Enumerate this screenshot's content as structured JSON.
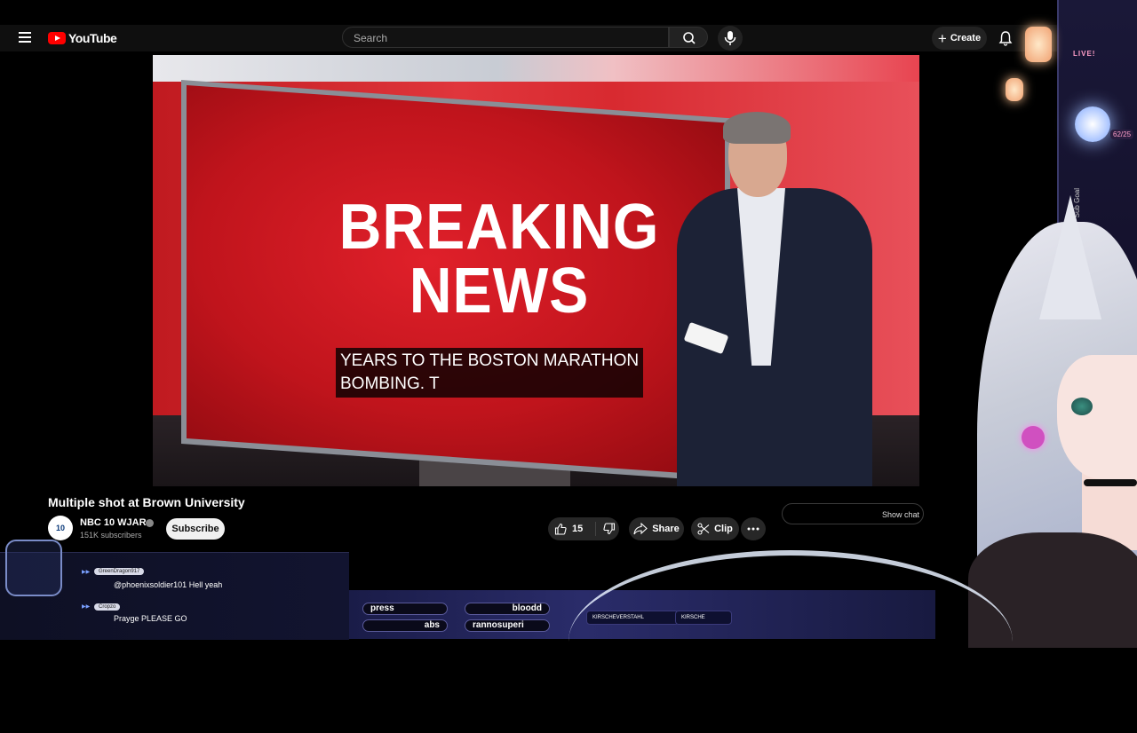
{
  "header": {
    "logo_text": "YouTube",
    "search_placeholder": "Search",
    "create_label": "Create"
  },
  "video": {
    "headline_line1": "BREAKING",
    "headline_line2": "NEWS",
    "caption_line1": "YEARS TO THE BOSTON MARATHON",
    "caption_line2": "BOMBING. T"
  },
  "meta": {
    "title": "Multiple shot at Brown University",
    "channel_name": "NBC 10 WJAR",
    "channel_avatar_text": "10",
    "subscribers": "151K subscribers",
    "subscribe_label": "Subscribe",
    "like_count": "15",
    "share_label": "Share",
    "clip_label": "Clip",
    "show_chat_label": "Show chat"
  },
  "stream_overlay": {
    "live_label": "LIVE!",
    "goal_count": "62/25",
    "goal_label": "Sub Goal",
    "chat": [
      {
        "user": "GreenDragon917",
        "message": "@phoenixsoldier101 Hell yeah"
      },
      {
        "user": "Cropzo",
        "message": "Prayge PLEASE GO"
      }
    ],
    "ticker_items": [
      "press",
      "bloodd",
      "abs",
      "rannosuperi"
    ],
    "socials": [
      "KIRSCHEVERSTAHL",
      "KIRSCHE"
    ]
  },
  "colors": {
    "youtube_red": "#ff0000",
    "page_bg": "#0f0f0f",
    "accent_pink": "#ff9ec8"
  }
}
